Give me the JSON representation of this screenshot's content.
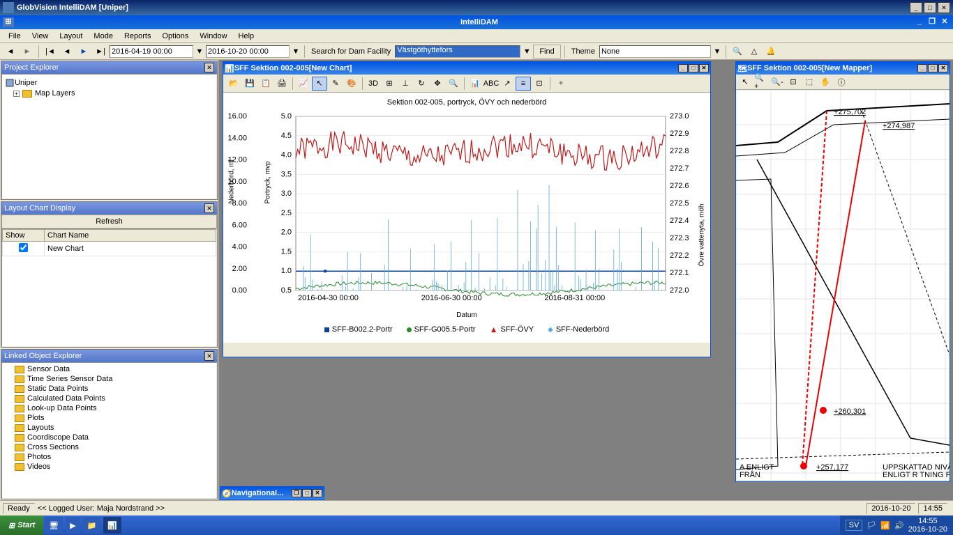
{
  "app": {
    "outer_title": "GlobVision IntelliDAM [Uniper]",
    "inner_title": "IntelliDAM"
  },
  "menu": [
    "File",
    "View",
    "Layout",
    "Mode",
    "Reports",
    "Options",
    "Window",
    "Help"
  ],
  "toolbar": {
    "date_from": "2016-04-19 00:00",
    "date_to": "2016-10-20 00:00",
    "search_label": "Search for Dam Facility",
    "facility": "Västgöthyttefors",
    "find_btn": "Find",
    "theme_label": "Theme",
    "theme_value": "None"
  },
  "project_explorer": {
    "title": "Project Explorer",
    "root": "Uniper",
    "child": "Map Layers"
  },
  "layout_chart": {
    "title": "Layout Chart Display",
    "refresh": "Refresh",
    "col_show": "Show",
    "col_name": "Chart Name",
    "row_name": "New Chart"
  },
  "linked_explorer": {
    "title": "Linked Object Explorer",
    "items": [
      "Sensor Data",
      "Time Series Sensor Data",
      "Static Data Points",
      "Calculated Data Points",
      "Look-up Data Points",
      "Plots",
      "Layouts",
      "Coordiscope Data",
      "Cross Sections",
      "Photos",
      "Videos"
    ]
  },
  "chart_window": {
    "title": "SFF Sektion 002-005[New Chart]"
  },
  "mapper_window": {
    "title": "SFF Sektion 002-005[New Mapper]",
    "labels": [
      "+275,702",
      "+274,987",
      "+260,301",
      "+257,177"
    ],
    "note_left_1": "A ENLIGT",
    "note_left_2": "FRÅN",
    "note_right_1": "UPPSKATTAD NIVÅ FÖR F",
    "note_right_2": "ENLIGT R TNING FRÅN BYG"
  },
  "nav_window": {
    "title": "Navigational..."
  },
  "status": {
    "ready": "Ready",
    "user": "<< Logged User: Maja Nordstrand >>",
    "date": "2016-10-20",
    "time": "14:55"
  },
  "taskbar": {
    "start": "Start",
    "lang": "SV",
    "tray_time": "14:55",
    "tray_date": "2016-10-20"
  },
  "chart_data": {
    "type": "line",
    "title": "Sektion 002-005, portryck, ÖVY och nederbörd",
    "xlabel": "Datum",
    "x_ticks": [
      "2016-04-30 00:00",
      "2016-06-30 00:00",
      "2016-08-31 00:00"
    ],
    "axes": [
      {
        "name": "Nederbörd, ml",
        "side": "left",
        "ticks": [
          0.0,
          2.0,
          4.0,
          6.0,
          8.0,
          10.0,
          12.0,
          14.0,
          16.0
        ],
        "range": [
          0,
          16
        ]
      },
      {
        "name": "Portryck, mvp",
        "side": "left-inner",
        "ticks": [
          0.5,
          1.0,
          1.5,
          2.0,
          2.5,
          3.0,
          3.5,
          4.0,
          4.5,
          5.0
        ],
        "range": [
          0.5,
          5.0
        ]
      },
      {
        "name": "Övre vattenyta, möh",
        "side": "right",
        "ticks": [
          272.0,
          272.1,
          272.2,
          272.3,
          272.4,
          272.5,
          272.6,
          272.7,
          272.8,
          272.9,
          273.0
        ],
        "range": [
          272.0,
          273.0
        ]
      }
    ],
    "series": [
      {
        "name": "SFF-B002.2-Portr",
        "color": "#1040a0",
        "axis": 1,
        "style": "line",
        "approx_const": 1.0
      },
      {
        "name": "SFF-G005.5-Portr",
        "color": "#2a8a2a",
        "axis": 1,
        "style": "line",
        "approx_range": [
          0.3,
          0.8
        ]
      },
      {
        "name": "SFF-ÖVY",
        "color": "#c01818",
        "axis": 2,
        "style": "line",
        "approx_range": [
          272.7,
          272.9
        ]
      },
      {
        "name": "SFF-Nederbörd",
        "color": "#5aa8e0",
        "axis": 0,
        "style": "spikes",
        "approx_range": [
          0,
          10
        ]
      }
    ]
  }
}
